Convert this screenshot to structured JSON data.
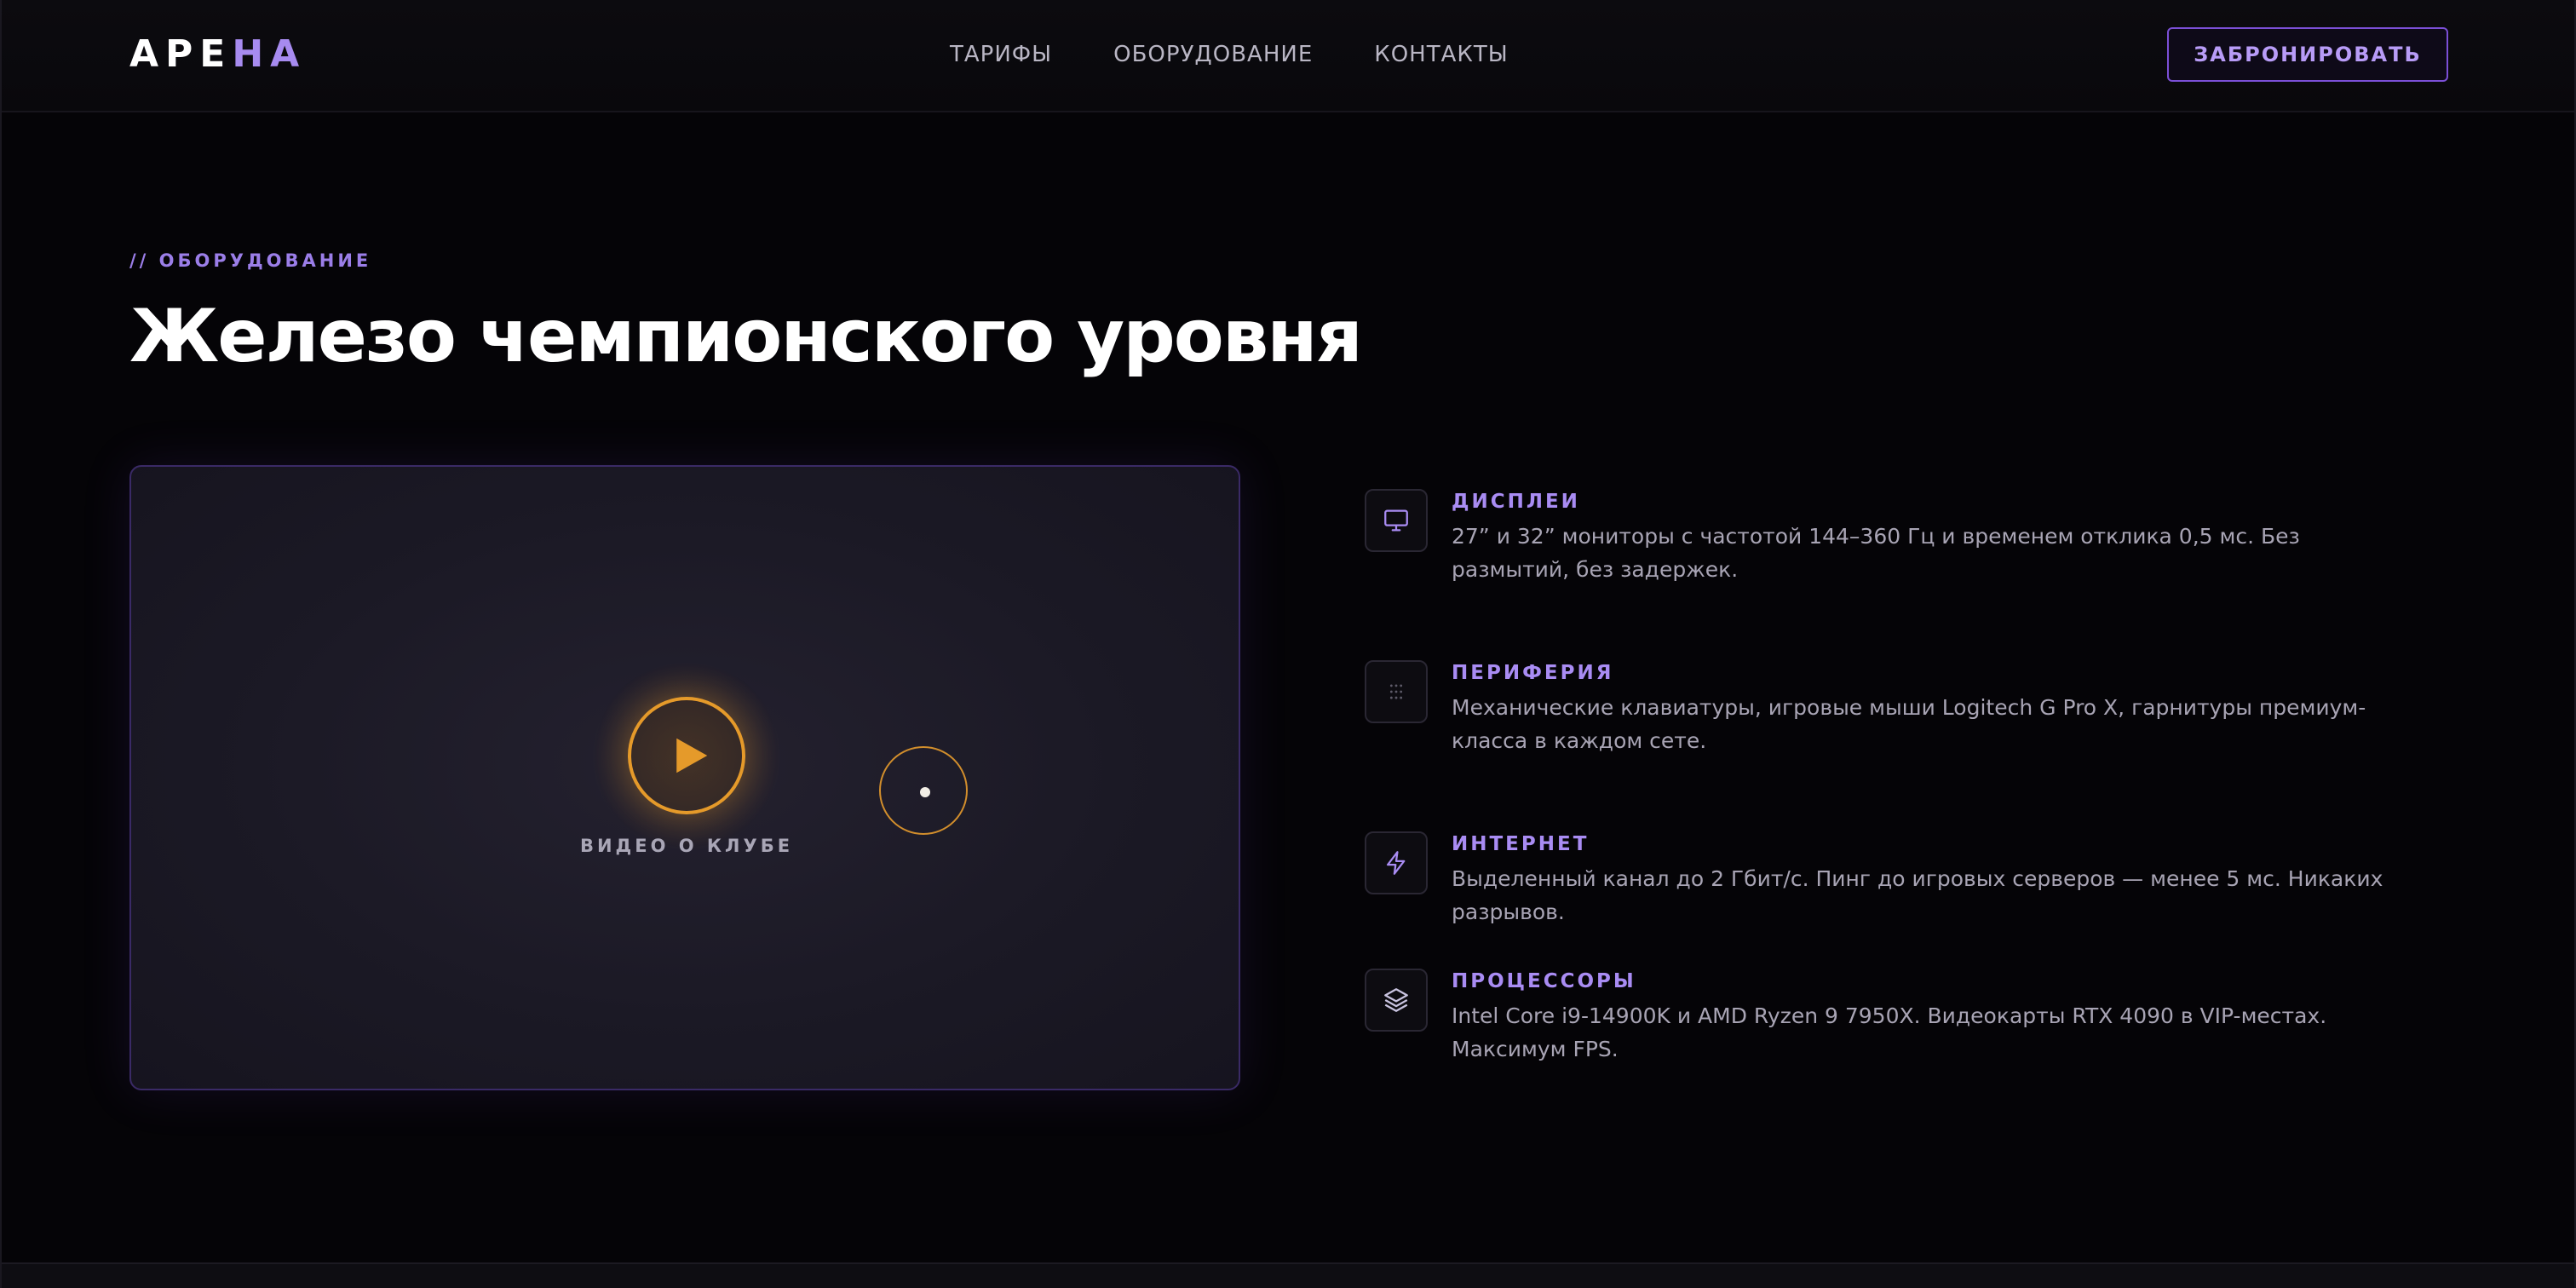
{
  "brand": {
    "logo_part1": "АРЕ",
    "logo_part2": "НА",
    "accent": "#a78bf0"
  },
  "nav": {
    "items": [
      "ТАРИФЫ",
      "ОБОРУДОВАНИЕ",
      "КОНТАКТЫ"
    ]
  },
  "header": {
    "cta_label": "ЗАБРОНИРОВАТЬ"
  },
  "section": {
    "eyebrow": "// ОБОРУДОВАНИЕ",
    "title": "Железо чемпионского уровня"
  },
  "video": {
    "label": "ВИДЕО О КЛУБЕ",
    "play_color": "#e59a2a",
    "icon": "play-icon"
  },
  "features": [
    {
      "icon": "monitor-icon",
      "title": "ДИСПЛЕИ",
      "description": "27” и 32” мониторы с частотой 144–360 Гц и временем отклика 0,5 мс. Без размытий, без задержек."
    },
    {
      "icon": "keypad-dots-icon",
      "title": "ПЕРИФЕРИЯ",
      "description": "Механические клавиатуры, игровые мыши Logitech G Pro X, гарнитуры премиум-класса в каждом сете."
    },
    {
      "icon": "lightning-icon",
      "title": "ИНТЕРНЕТ",
      "description": "Выделенный канал до 2 Гбит/с. Пинг до игровых серверов — менее 5 мс. Никаких разрывов."
    },
    {
      "icon": "layers-icon",
      "title": "ПРОЦЕССОРЫ",
      "description": "Intel Core i9-14900K и AMD Ryzen 9 7950X. Видеокарты RTX 4090 в VIP-местах. Максимум FPS."
    }
  ]
}
